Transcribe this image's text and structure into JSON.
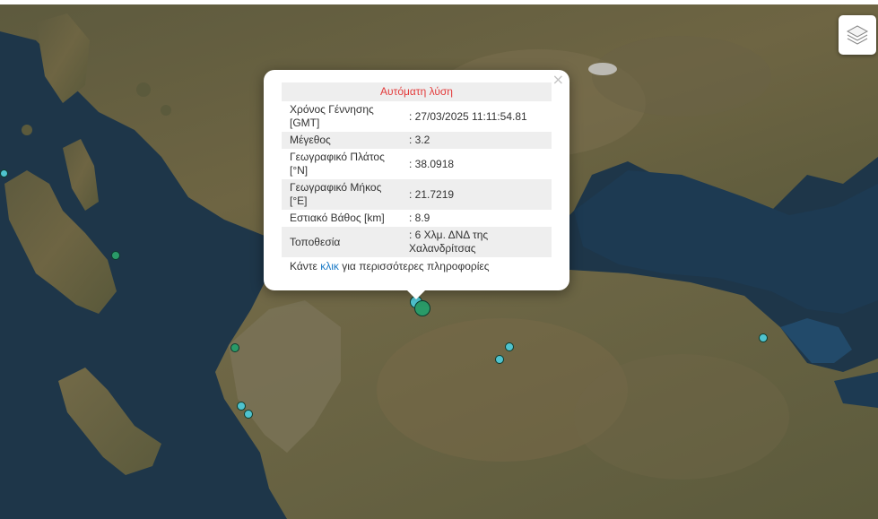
{
  "popup": {
    "title": "Αυτόματη λύση",
    "close": "×",
    "rows": [
      {
        "label": "Χρόνος Γέννησης [GMT]",
        "value": ": 27/03/2025 11:11:54.81"
      },
      {
        "label": "Μέγεθος",
        "value": ": 3.2"
      },
      {
        "label": "Γεωγραφικό Πλάτος [°N]",
        "value": ": 38.0918"
      },
      {
        "label": "Γεωγραφικό Μήκος [°E]",
        "value": ": 21.7219"
      },
      {
        "label": "Εστιακό Βάθος [km]",
        "value": ": 8.9"
      },
      {
        "label": "Τοποθεσία",
        "value": ": 6 Χλμ. ΔΝΔ της Χαλανδρίτσας"
      }
    ],
    "more_prefix": "Κάντε",
    "more_link": "κλικ",
    "more_suffix": "για περισσότερες πληροφορίες"
  },
  "layers_icon": "layers-icon",
  "colors": {
    "recent": "#4fc3cf",
    "older": "#2a9a68",
    "popup_title": "#e33b3b",
    "link": "#1a7ac6"
  }
}
